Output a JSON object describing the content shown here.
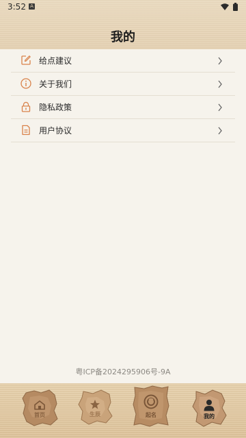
{
  "status_bar": {
    "time": "3:52",
    "notification_letter": "A"
  },
  "header": {
    "title": "我的"
  },
  "menu": {
    "items": [
      {
        "label": "给点建议",
        "icon": "edit-icon"
      },
      {
        "label": "关于我们",
        "icon": "info-icon"
      },
      {
        "label": "隐私政策",
        "icon": "lock-icon"
      },
      {
        "label": "用户协议",
        "icon": "document-icon"
      }
    ]
  },
  "footer": {
    "icp": "粤ICP备2024295906号-9A"
  },
  "tabbar": {
    "tabs": [
      {
        "label": "首页",
        "icon": "home-icon",
        "active": false
      },
      {
        "label": "生辰",
        "icon": "star-icon",
        "active": false
      },
      {
        "label": "起名",
        "icon": "name-icon",
        "active": false
      },
      {
        "label": "我的",
        "icon": "person-icon",
        "active": true
      }
    ]
  },
  "colors": {
    "accent": "#d9824a",
    "header_bg": "#e6d3b4",
    "page_bg": "#f6f3ec",
    "tab_bg": "#e3cba4"
  }
}
